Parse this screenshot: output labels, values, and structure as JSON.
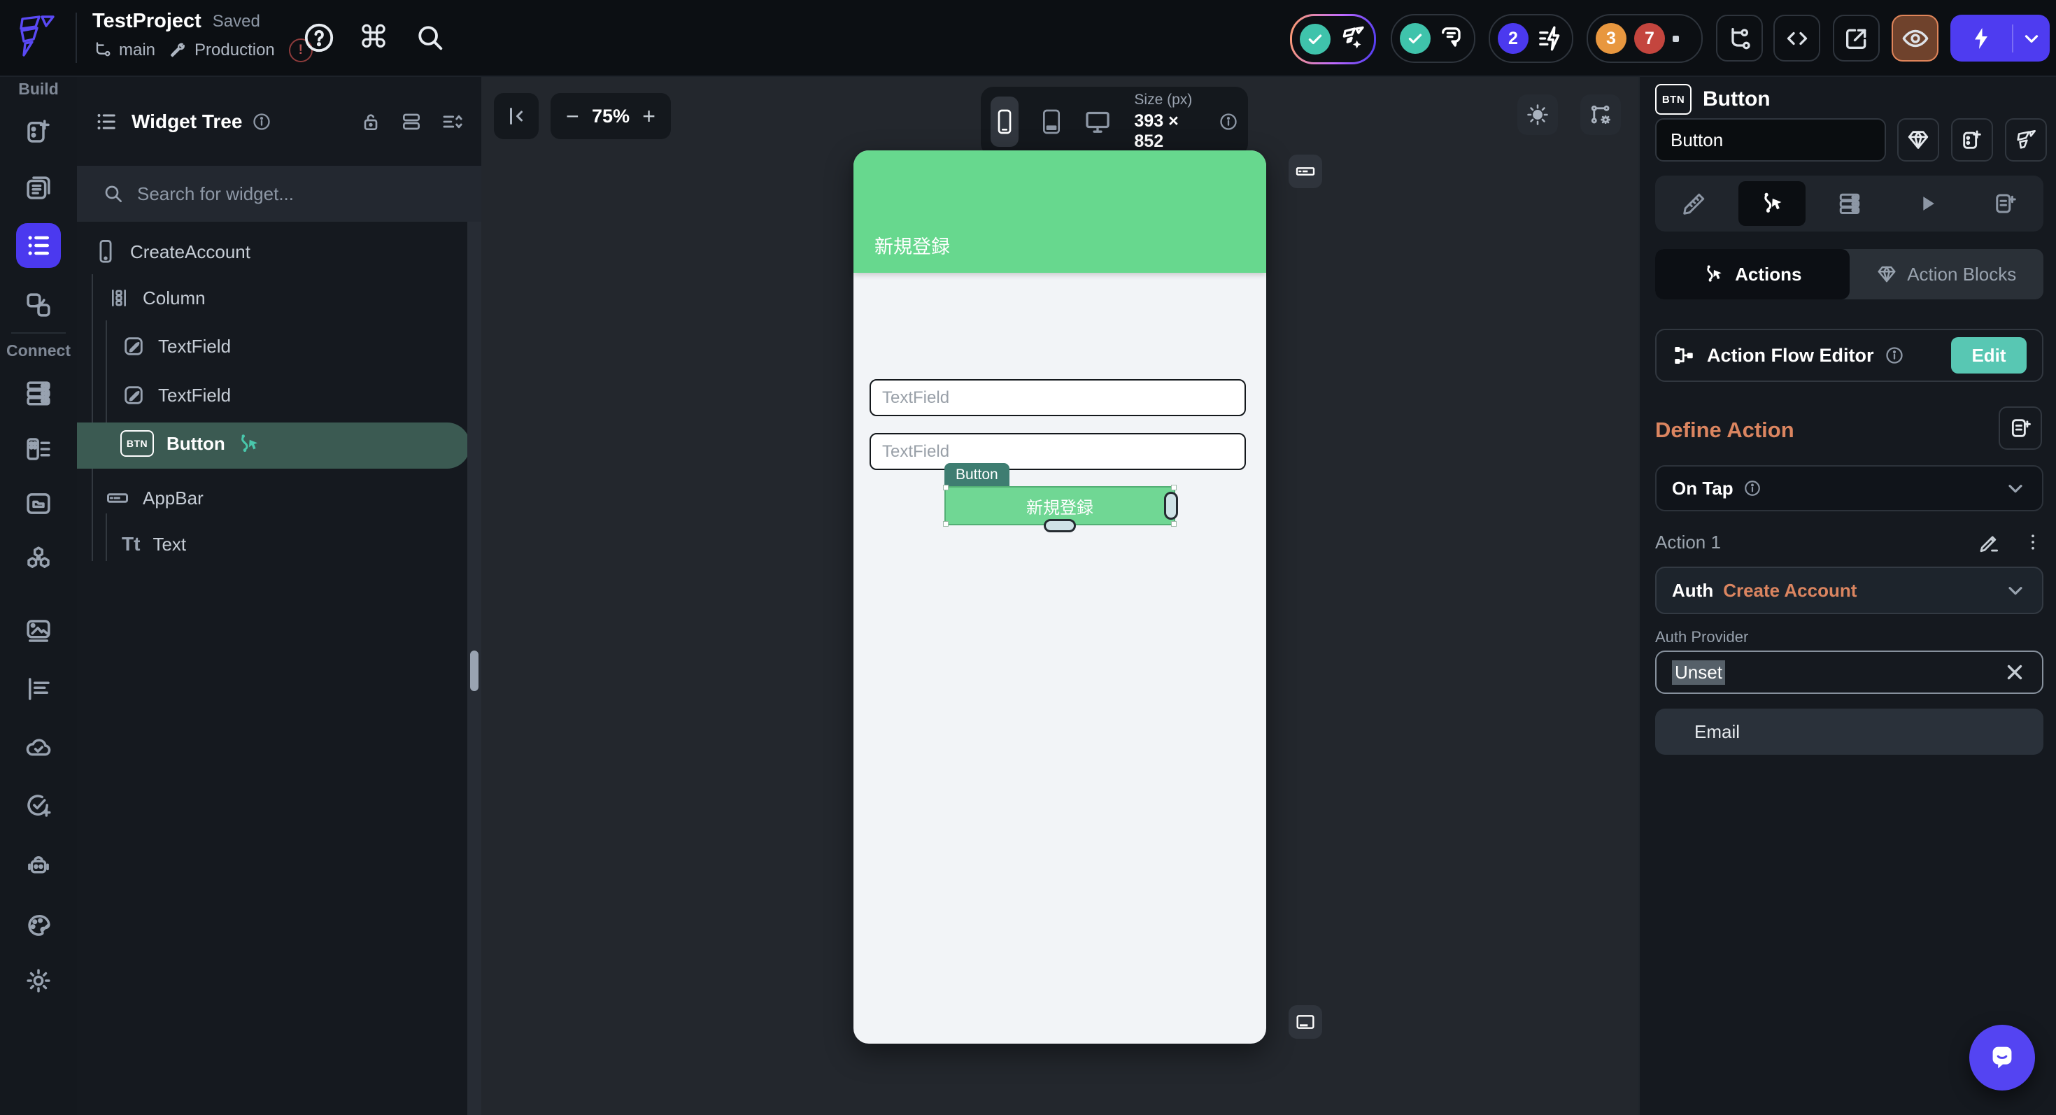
{
  "topbar": {
    "project": "TestProject",
    "saved": "Saved",
    "branch": "main",
    "environment": "Production",
    "badges": {
      "actions_count": "2",
      "warnings_count": "3",
      "errors_count": "7"
    }
  },
  "rail": {
    "build_label": "Build",
    "connect_label": "Connect"
  },
  "widget_tree": {
    "title": "Widget Tree",
    "search_placeholder": "Search for widget...",
    "items": [
      {
        "label": "CreateAccount"
      },
      {
        "label": "Column"
      },
      {
        "label": "TextField"
      },
      {
        "label": "TextField"
      },
      {
        "label": "Button"
      },
      {
        "label": "AppBar"
      },
      {
        "label": "Text"
      }
    ]
  },
  "canvas": {
    "zoom": "75%",
    "size_label": "Size (px)",
    "size_value": "393 × 852",
    "phone": {
      "appbar_title": "新規登録",
      "textfield1_placeholder": "TextField",
      "textfield2_placeholder": "TextField",
      "button_label": "新規登録",
      "selection_tooltip": "Button"
    }
  },
  "inspector": {
    "title": "Button",
    "name_value": "Button",
    "tabs": {
      "actions": "Actions",
      "action_blocks": "Action Blocks"
    },
    "action_flow_editor": "Action Flow Editor",
    "edit_button": "Edit",
    "define_action": "Define Action",
    "trigger": "On Tap",
    "action_label": "Action 1",
    "action_type_prefix": "Auth",
    "action_type": "Create Account",
    "auth_provider_label": "Auth Provider",
    "auth_provider_value": "Unset",
    "dropdown_option": "Email"
  },
  "icons": {
    "btn_badge": "BTN",
    "text_widget_glyph": "Tt",
    "help_glyph": "?",
    "command_glyph": "⌘",
    "warning_glyph": "!",
    "zoom_out_glyph": "−",
    "zoom_in_glyph": "+"
  },
  "colors": {
    "accent": "#4b39ef",
    "app_green": "#67d88e",
    "check_teal": "#3fc3ab",
    "selection_teal": "#3b5a52",
    "heading_orange": "#db8560",
    "edit_teal": "#58c7b3",
    "error_red": "#c4453e",
    "warning_orange": "#e8973f",
    "eye_highlight": "#e0855a"
  }
}
